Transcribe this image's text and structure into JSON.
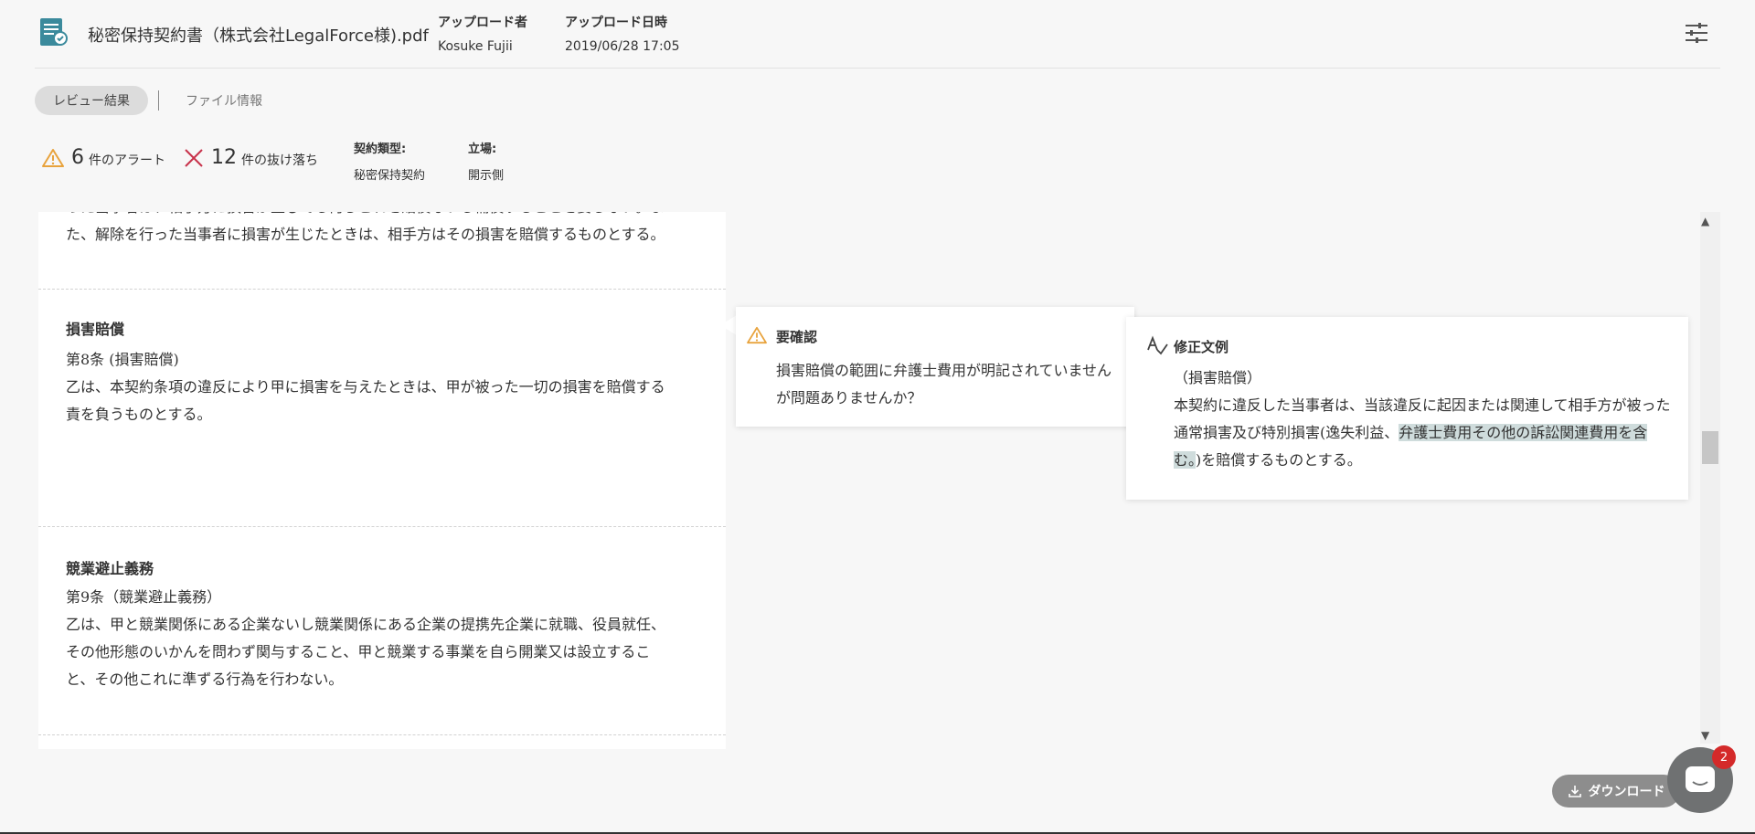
{
  "header": {
    "file_name": "秘密保持契約書（株式会社LegalForce様).pdf",
    "uploader_label": "アップロード者",
    "uploader_value": "Kosuke Fujii",
    "uploaded_at_label": "アップロード日時",
    "uploaded_at_value": "2019/06/28 17:05",
    "file_icon": "document-icon",
    "settings_icon": "sliders-icon"
  },
  "tabs": [
    {
      "label": "レビュー結果",
      "active": true
    },
    {
      "label": "ファイル情報",
      "active": false
    }
  ],
  "summary": {
    "alerts_count": "6",
    "alerts_unit": "件のアラート",
    "missing_count": "12",
    "missing_unit": "件の抜け落ち",
    "contract_type_label": "契約類型:",
    "contract_type_value": "秘密保持契約",
    "position_label": "立場:",
    "position_value": "開示側"
  },
  "document": {
    "top_partial_line1": "った当事者は、相手方に損害が生じても何らこれを賠償ないし補償することを要しない。ま",
    "top_partial_line2": "た、解除を行った当事者に損害が生じたときは、相手方はその損害を賠償するものとする。",
    "sections": [
      {
        "title": "損害賠償",
        "article": "第8条 (損害賠償)",
        "body_line1": "乙は、本契約条項の違反により甲に損害を与えたときは、甲が被った一切の損害を賠償する",
        "body_line2": "責を負うものとする。"
      },
      {
        "title": "競業避止義務",
        "article": "第9条（競業避止義務）",
        "body_line1": "乙は、甲と競業関係にある企業ないし競業関係にある企業の提携先企業に就職、役員就任、",
        "body_line2": "その他形態のいかんを問わず関与すること、甲と競業する事業を自ら開業又は設立するこ",
        "body_line3": "と、その他これに準ずる行為を行わない。"
      }
    ]
  },
  "alert": {
    "icon": "warning-icon",
    "title": "要確認",
    "text": "損害賠償の範囲に弁護士費用が明記されていませんが問題ありませんか？"
  },
  "revision": {
    "icon": "spell-check-icon",
    "title": "修正文例",
    "heading": "（損害賠償）",
    "text_before": "本契約に違反した当事者は、当該違反に起因または関連して相手方が被った通常損害及び特別損害(逸失利益、",
    "text_highlight": "弁護士費用その他の訴訟関連費用を含む。",
    "text_after": ")を賠償するものとする。"
  },
  "actions": {
    "download_label": "ダウンロード",
    "download_icon": "download-icon",
    "chat_icon": "chat-icon",
    "chat_badge": "2"
  },
  "colors": {
    "alert_orange": "#e8a33d",
    "missing_red": "#c8324b",
    "highlight": "#cfdcdc",
    "badge_red": "#d42a2a"
  }
}
